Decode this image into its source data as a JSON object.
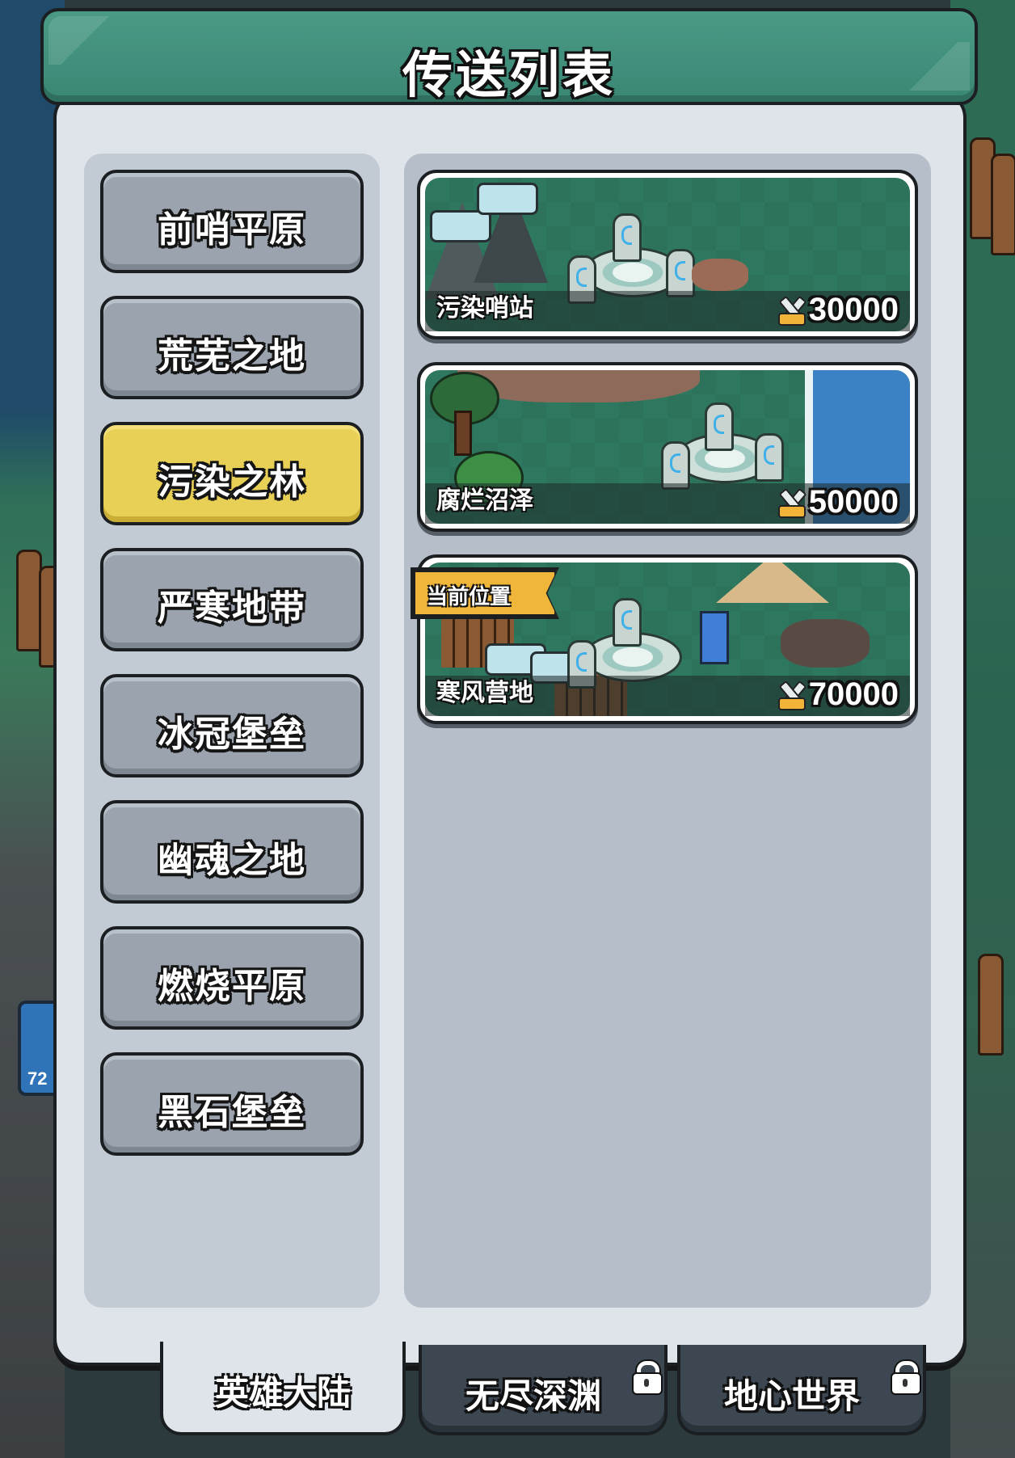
{
  "header": {
    "title": "传送列表"
  },
  "regions": [
    {
      "label": "前哨平原",
      "active": false
    },
    {
      "label": "荒芜之地",
      "active": false
    },
    {
      "label": "污染之林",
      "active": true
    },
    {
      "label": "严寒地带",
      "active": false
    },
    {
      "label": "冰冠堡垒",
      "active": false
    },
    {
      "label": "幽魂之地",
      "active": false
    },
    {
      "label": "燃烧平原",
      "active": false
    },
    {
      "label": "黑石堡垒",
      "active": false
    }
  ],
  "destinations": [
    {
      "name": "污染哨站",
      "cost": "30000",
      "icon": "crossed-swords-icon"
    },
    {
      "name": "腐烂沼泽",
      "cost": "50000",
      "icon": "crossed-swords-icon"
    },
    {
      "name": "寒风营地",
      "cost": "70000",
      "icon": "crossed-swords-icon",
      "tag": "当前位置"
    }
  ],
  "tabs": [
    {
      "label": "英雄大陆",
      "active": true,
      "locked": false
    },
    {
      "label": "无尽深渊",
      "active": false,
      "locked": true
    },
    {
      "label": "地心世界",
      "active": false,
      "locked": true
    }
  ],
  "background": {
    "tile_number": "72"
  },
  "colors": {
    "header": "#3a8774",
    "active_region": "#e8cf55",
    "region": "#9aa3ae",
    "tag": "#f0b63a"
  }
}
